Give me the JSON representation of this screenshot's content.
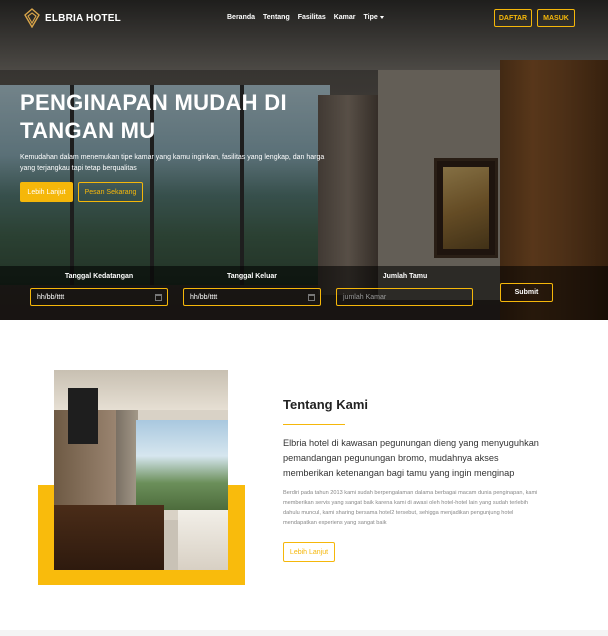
{
  "brand": {
    "name": "ELBRIA HOTEL",
    "logo_icon": "elbria-logo-icon"
  },
  "nav": {
    "items": [
      "Beranda",
      "Tentang",
      "Fasilitas",
      "Kamar",
      "Tipe"
    ],
    "daftar": "DAFTAR",
    "masuk": "MASUK"
  },
  "hero": {
    "title": "PENGINAPAN MUDAH DI TANGAN MU",
    "description": "Kemudahan dalam menemukan tipe kamar yang kamu inginkan, fasilitas yang lengkap, dan harga yang terjangkau tapi tetap berqualitas",
    "primary_button": "Lebih Lanjut",
    "secondary_button": "Pesan Sekarang"
  },
  "booking": {
    "checkin_label": "Tanggal Kedatangan",
    "checkin_value": "hh/bb/tttt",
    "checkout_label": "Tanggal Keluar",
    "checkout_value": "hh/bb/tttt",
    "guests_label": "Jumlah Tamu",
    "guests_placeholder": "jumlah Kamar",
    "submit": "Submit"
  },
  "about": {
    "title": "Tentang Kami",
    "lead": "Elbria hotel di kawasan pegunungan dieng yang menyuguhkan pemandangan pegunungan bromo, mudahnya akses memberikan ketenangan bagi tamu yang ingin menginap",
    "body": "Berdiri pada tahun 2013 kami sudah berpengalaman dalama berbagai macam dunia penginapan, kami memberikan servis yang sangat baik karena kami di awasi oleh hotel-hotel lain yang sudah terlebih dahulu muncul, kami sharing bersama hotel2 tersebut, sehigga menjadikan pengunjung hotel mendapatkan experiens yang sangat baik",
    "button": "Lebih Lanjut"
  },
  "colors": {
    "accent": "#f5b70a",
    "about_block": "#f9bb0c"
  }
}
